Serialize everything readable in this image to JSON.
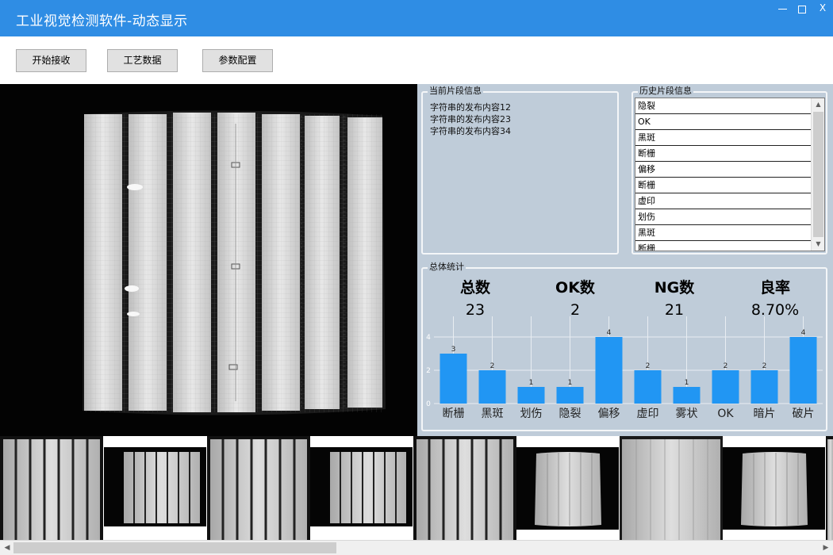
{
  "window": {
    "title": "工业视觉检测软件-动态显示",
    "controls": {
      "minimize_icon": "minimize-icon",
      "maximize_icon": "maximize-icon",
      "close_label": "X"
    }
  },
  "toolbar": {
    "start_label": "开始接收",
    "process_label": "工艺数据",
    "params_label": "参数配置"
  },
  "current_segment": {
    "title": "当前片段信息",
    "lines": [
      "字符串的发布内容12",
      "字符串的发布内容23",
      "字符串的发布内容34"
    ]
  },
  "history_segment": {
    "title": "历史片段信息",
    "items": [
      "隐裂",
      "OK",
      "黑斑",
      "断栅",
      "偏移",
      "断栅",
      "虚印",
      "划伤",
      "黑斑",
      "断栅"
    ]
  },
  "stats": {
    "title": "总体统计",
    "total_label": "总数",
    "total_value": "23",
    "ok_label": "OK数",
    "ok_value": "2",
    "ng_label": "NG数",
    "ng_value": "21",
    "yield_label": "良率",
    "yield_value": "8.70%"
  },
  "chart_data": {
    "type": "bar",
    "categories": [
      "断栅",
      "黑斑",
      "划伤",
      "隐裂",
      "偏移",
      "虚印",
      "雾状",
      "OK",
      "暗片",
      "破片"
    ],
    "values": [
      3,
      2,
      1,
      1,
      4,
      2,
      1,
      2,
      2,
      4
    ],
    "yticks": [
      0,
      2,
      4
    ],
    "ylim": [
      0,
      4
    ],
    "bar_color": "#2196f3",
    "grid": true
  },
  "colors": {
    "title_bar": "#2f8de4",
    "panel_bg": "#bfccd9",
    "bar": "#2196f3"
  }
}
